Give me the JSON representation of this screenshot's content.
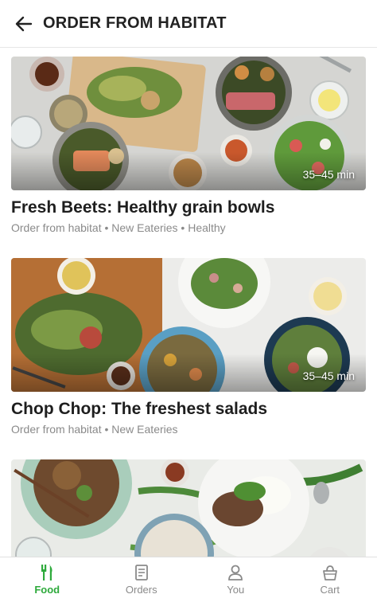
{
  "header": {
    "title": "ORDER FROM HABITAT",
    "back_icon": "arrow-left-icon"
  },
  "cards": [
    {
      "title": "Fresh Beets: Healthy grain bowls",
      "subtitle": "Order from habitat • New Eateries • Healthy",
      "eta": "35–45 min"
    },
    {
      "title": "Chop Chop: The freshest salads",
      "subtitle": "Order from habitat • New Eateries",
      "eta": "35–45 min"
    },
    {
      "title": "",
      "subtitle": "",
      "eta": ""
    }
  ],
  "nav": {
    "items": [
      {
        "label": "Food",
        "icon": "utensils-icon",
        "active": true
      },
      {
        "label": "Orders",
        "icon": "receipt-icon",
        "active": false
      },
      {
        "label": "You",
        "icon": "person-icon",
        "active": false
      },
      {
        "label": "Cart",
        "icon": "basket-icon",
        "active": false
      }
    ]
  },
  "colors": {
    "accent": "#2eaa3c",
    "muted": "#8a8a8a"
  }
}
